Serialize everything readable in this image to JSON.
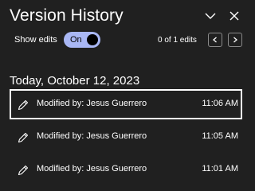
{
  "panel": {
    "title": "Version History",
    "header_icons": [
      "chevron-down-icon",
      "close-icon"
    ]
  },
  "controls": {
    "show_edits_label": "Show edits",
    "toggle_label": "On",
    "toggle_on": true,
    "edits_count": "0 of 1 edits",
    "nav_icons": [
      "chevron-left-icon",
      "chevron-right-icon"
    ],
    "toggle_color": "#a9b7f4"
  },
  "history": {
    "date": "Today, October 12, 2023",
    "entries": [
      {
        "label": "Modified by: Jesus Guerrero",
        "time": "11:06 AM",
        "selected": true,
        "icon": "pencil-icon"
      },
      {
        "label": "Modified by: Jesus Guerrero",
        "time": "11:05 AM",
        "selected": false,
        "icon": "pencil-icon"
      },
      {
        "label": "Modified by: Jesus Guerrero",
        "time": "11:01 AM",
        "selected": false,
        "icon": "pencil-icon"
      }
    ]
  },
  "colors": {
    "background": "#202020",
    "text": "#ffffff",
    "selection_border": "#ffffff",
    "button_border": "#8a8a8a"
  }
}
